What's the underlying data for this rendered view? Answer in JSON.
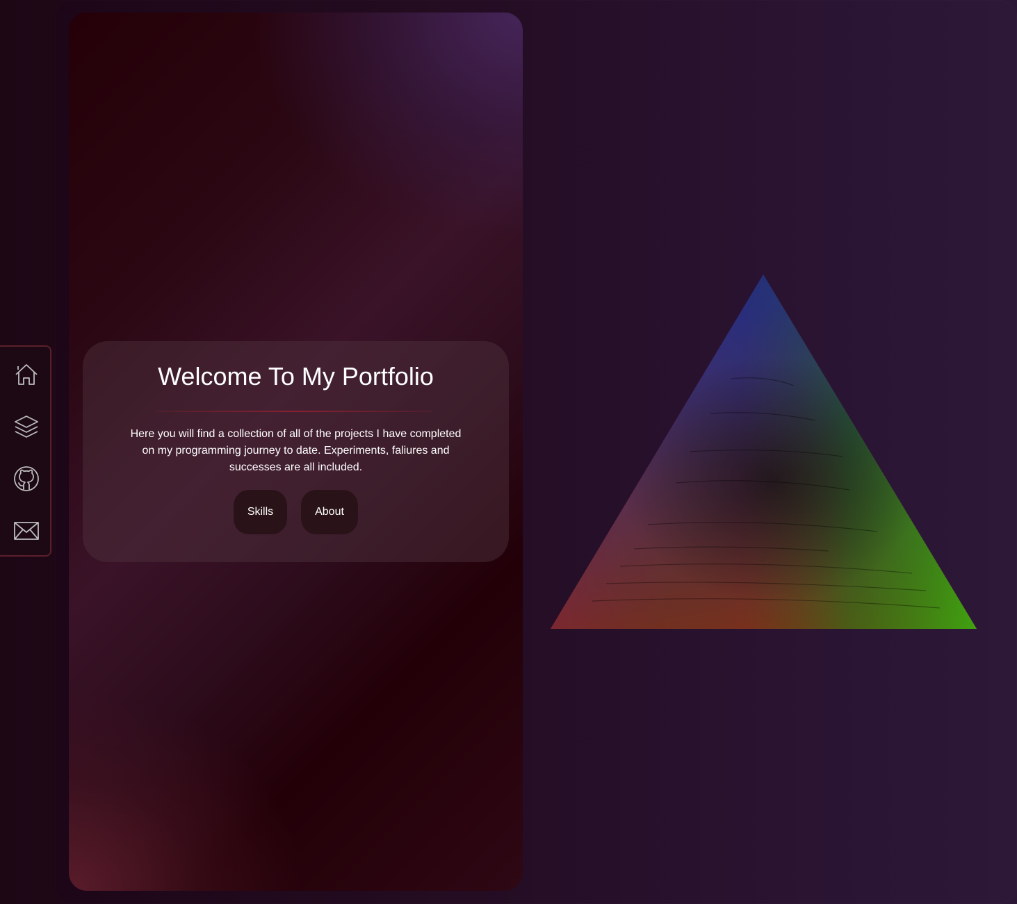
{
  "hero": {
    "title": "Welcome To My Portfolio",
    "description": "Here you will find a collection of all of the projects I have completed on my programming journey to date. Experiments, faliures and successes are all included.",
    "buttons": {
      "skills": "Skills",
      "about": "About"
    }
  },
  "sidebar": {
    "items": [
      {
        "icon": "home-icon"
      },
      {
        "icon": "layers-icon"
      },
      {
        "icon": "github-icon"
      },
      {
        "icon": "mail-icon"
      }
    ]
  },
  "colors": {
    "sidebar_border": "#5b1f2c",
    "button_bg": "#2a1318",
    "text": "#ffffff",
    "divider": "#8a2030",
    "prism_top": "#1a0a8c",
    "prism_mid": "#8a0c8a",
    "prism_left": "#d01010",
    "prism_right": "#3aaa10"
  }
}
